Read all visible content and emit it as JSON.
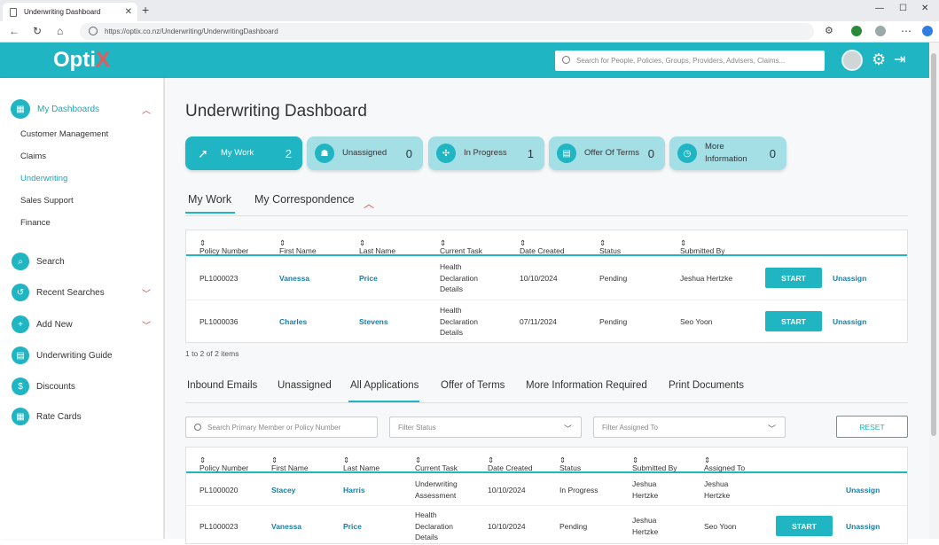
{
  "browser": {
    "tab_title": "Underwriting Dashboard",
    "url": "https://optix.co.nz/Underwriting/UnderwritingDashboard"
  },
  "app": {
    "logo": "Opti",
    "logo_x": "X",
    "search_placeholder": "Search for People, Policies, Groups, Providers, Advisers, Claims...",
    "accent": "#1fb5c3"
  },
  "sidebar": {
    "header": "My Dashboards",
    "subitems": [
      "Customer Management",
      "Claims",
      "Underwriting",
      "Sales Support",
      "Finance"
    ],
    "items": [
      "Search",
      "Recent Searches",
      "Add New",
      "Underwriting Guide",
      "Discounts",
      "Rate Cards"
    ]
  },
  "page": {
    "title": "Underwriting Dashboard",
    "cards": [
      {
        "label": "My Work",
        "count": "2"
      },
      {
        "label": "Unassigned",
        "count": "0"
      },
      {
        "label": "In Progress",
        "count": "1"
      },
      {
        "label": "Offer Of Terms",
        "count": "0"
      },
      {
        "label": "More Information",
        "count": "0"
      }
    ],
    "tabs1": [
      "My Work",
      "My Correspondence"
    ],
    "table1": {
      "headers": [
        "Policy Number",
        "First Name",
        "Last Name",
        "Current Task",
        "Date Created",
        "Status",
        "Submitted By"
      ],
      "rows": [
        [
          "PL1000023",
          "Vanessa",
          "Price",
          "Health Declaration Details",
          "10/10/2024",
          "Pending",
          "Jeshua Hertzke"
        ],
        [
          "PL1000036",
          "Charles",
          "Stevens",
          "Health Declaration Details",
          "07/11/2024",
          "Pending",
          "Seo Yoon"
        ]
      ],
      "start_label": "START",
      "unassign_label": "Unassign"
    },
    "items_text": "1 to 2 of 2 items",
    "tabs2": [
      "Inbound Emails",
      "Unassigned",
      "All Applications",
      "Offer of Terms",
      "More Information Required",
      "Print Documents"
    ],
    "filters": {
      "search_placeholder": "Search Primary Member or Policy Number",
      "status_placeholder": "Filter Status",
      "assigned_placeholder": "Filter Assigned To",
      "reset_label": "RESET"
    },
    "table2": {
      "headers": [
        "Policy Number",
        "First Name",
        "Last Name",
        "Current Task",
        "Date Created",
        "Status",
        "Submitted By",
        "Assigned To"
      ],
      "rows": [
        [
          "PL1000020",
          "Stacey",
          "Harris",
          "Underwriting Assessment",
          "10/10/2024",
          "In Progress",
          "Jeshua Hertzke",
          "Jeshua Hertzke"
        ],
        [
          "PL1000023",
          "Vanessa",
          "Price",
          "Health Declaration Details",
          "10/10/2024",
          "Pending",
          "Jeshua Hertzke",
          "Seo Yoon"
        ]
      ],
      "start_label": "START",
      "unassign_label": "Unassign"
    }
  }
}
